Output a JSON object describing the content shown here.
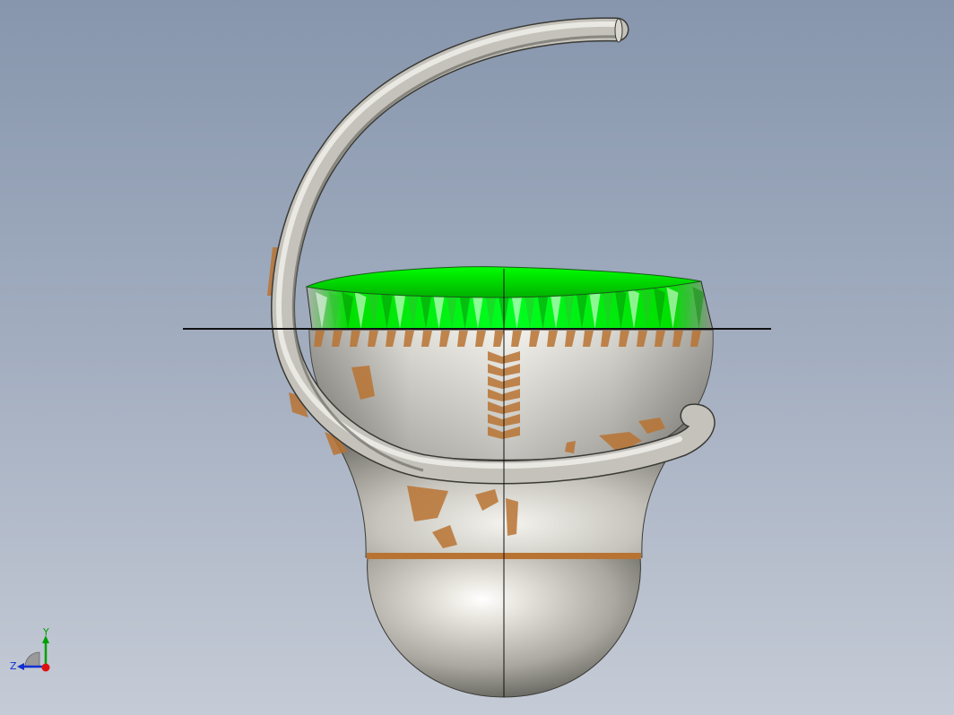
{
  "viewport": {
    "background_top": "#8796ad",
    "background_bottom": "#c5cbd6"
  },
  "model": {
    "body_color": "#c9c7bf",
    "rim_color": "#00e000",
    "decal_color": "#b87333",
    "edge_color": "#1a1a1a",
    "handle_color": "#c4c2ba"
  },
  "triad": {
    "y_label": "Y",
    "z_label": "Z",
    "y_color": "#00a000",
    "z_color": "#1030d0",
    "x_color": "#e01010"
  }
}
